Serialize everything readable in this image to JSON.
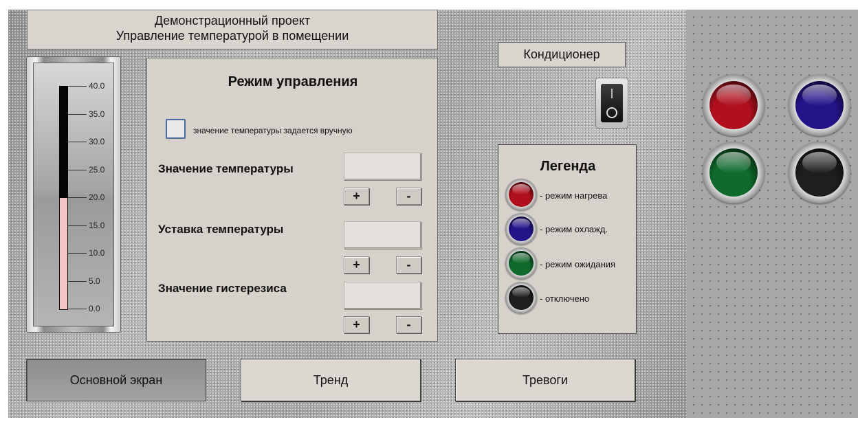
{
  "header": {
    "title_line1": "Демонстрационный проект",
    "title_line2": "Управление температурой в помещении"
  },
  "thermometer": {
    "tick_labels": [
      "40.0",
      "35.0",
      "30.0",
      "25.0",
      "20.0",
      "15.0",
      "10.0",
      "5.0",
      "0.0"
    ],
    "scale_min": 0,
    "scale_max": 40,
    "current_level": 20,
    "fill_color": "#f5c6c6"
  },
  "control_panel": {
    "title": "Режим управления",
    "manual_checkbox_label": "значение температуры задается вручную",
    "manual_checked": false,
    "temperature_label": "Значение температуры",
    "temperature_value": "",
    "setpoint_label": "Уставка температуры",
    "setpoint_value": "",
    "hysteresis_label": "Значение гистерезиса",
    "hysteresis_value": "",
    "plus_label": "+",
    "minus_label": "-"
  },
  "air_conditioner": {
    "label": "Кондиционер",
    "state": "off"
  },
  "legend": {
    "title": "Легенда",
    "items": [
      {
        "label": "- режим нагрева",
        "color": "#b0101e"
      },
      {
        "label": "- режим охлажд.",
        "color": "#24148a"
      },
      {
        "label": "- режим ожидания",
        "color": "#0f6a2c"
      },
      {
        "label": "- отключено",
        "color": "#1e1e1e"
      }
    ]
  },
  "status_lamps": [
    {
      "name": "heating",
      "color": "#b0101e"
    },
    {
      "name": "cooling",
      "color": "#24148a"
    },
    {
      "name": "standby",
      "color": "#0f6a2c"
    },
    {
      "name": "off",
      "color": "#1e1e1e"
    }
  ],
  "nav": {
    "main_screen": "Основной экран",
    "trend": "Тренд",
    "alarms": "Тревоги",
    "active": "main_screen"
  }
}
